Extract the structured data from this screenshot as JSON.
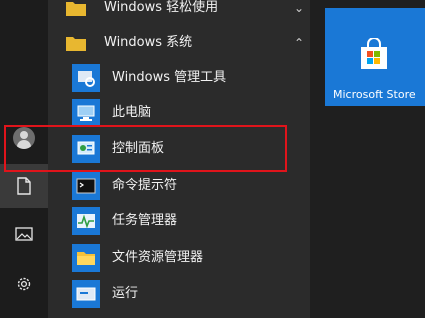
{
  "apps": {
    "folder_ease": {
      "label": "Windows 轻松使用",
      "chevron": "⌄"
    },
    "folder_system": {
      "label": "Windows 系统",
      "chevron": "⌃"
    },
    "items": [
      {
        "label": "Windows 管理工具",
        "icon": "admin-tools-icon"
      },
      {
        "label": "此电脑",
        "icon": "this-pc-icon"
      },
      {
        "label": "控制面板",
        "icon": "control-panel-icon"
      },
      {
        "label": "命令提示符",
        "icon": "command-prompt-icon"
      },
      {
        "label": "任务管理器",
        "icon": "task-manager-icon"
      },
      {
        "label": "文件资源管理器",
        "icon": "file-explorer-icon"
      },
      {
        "label": "运行",
        "icon": "run-icon"
      }
    ]
  },
  "tiles": {
    "store_label": "Microsoft Store"
  },
  "rail": {
    "icons": [
      "user-avatar-icon",
      "document-icon",
      "pictures-icon",
      "settings-icon"
    ]
  },
  "colors": {
    "accent": "#1a78d6",
    "highlight": "#e0141b"
  }
}
